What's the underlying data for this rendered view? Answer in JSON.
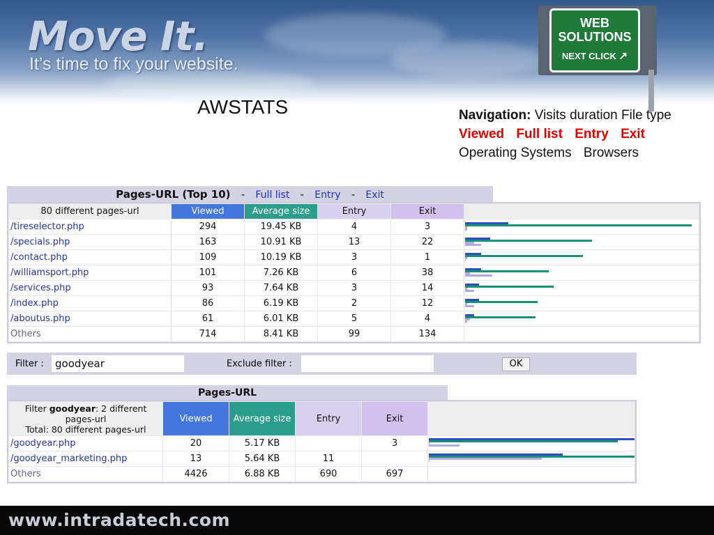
{
  "header": {
    "brand": "Move It.",
    "tagline": "It’s time to fix your website.",
    "sign": {
      "line1": "WEB",
      "line2": "SOLUTIONS",
      "line3": "NEXT CLICK",
      "arrow": "up-right-arrow-icon"
    }
  },
  "title": "AWSTATS",
  "navigation": {
    "label": "Navigation:",
    "items_line1": [
      "Visits duration",
      "File type"
    ],
    "items_red": [
      "Viewed",
      "Full list",
      "Entry",
      "Exit"
    ],
    "items_line3": [
      "Operating Systems",
      "Browsers"
    ]
  },
  "top_table": {
    "title": "Pages-URL (Top 10)",
    "links": [
      "Full list",
      "Entry",
      "Exit"
    ],
    "separator": "-",
    "summary": "80 different pages-url",
    "columns": [
      "Viewed",
      "Average size",
      "Entry",
      "Exit"
    ],
    "rows": [
      {
        "url": "/tireselector.php",
        "viewed": "294",
        "avg": "19.45 KB",
        "entry": "4",
        "exit": "3"
      },
      {
        "url": "/specials.php",
        "viewed": "163",
        "avg": "10.91 KB",
        "entry": "13",
        "exit": "22"
      },
      {
        "url": "/contact.php",
        "viewed": "109",
        "avg": "10.19 KB",
        "entry": "3",
        "exit": "1"
      },
      {
        "url": "/williamsport.php",
        "viewed": "101",
        "avg": "7.26 KB",
        "entry": "6",
        "exit": "38"
      },
      {
        "url": "/services.php",
        "viewed": "93",
        "avg": "7.64 KB",
        "entry": "3",
        "exit": "14"
      },
      {
        "url": "/index.php",
        "viewed": "86",
        "avg": "6.19 KB",
        "entry": "2",
        "exit": "12"
      },
      {
        "url": "/aboutus.php",
        "viewed": "61",
        "avg": "6.01 KB",
        "entry": "5",
        "exit": "4"
      }
    ],
    "others": {
      "label": "Others",
      "viewed": "714",
      "avg": "8.41 KB",
      "entry": "99",
      "exit": "134"
    },
    "bars": [
      [
        0.19,
        1.0,
        0.01,
        0.01
      ],
      [
        0.11,
        0.56,
        0.04,
        0.07
      ],
      [
        0.07,
        0.52,
        0.01,
        0.0
      ],
      [
        0.07,
        0.37,
        0.02,
        0.12
      ],
      [
        0.06,
        0.39,
        0.01,
        0.04
      ],
      [
        0.06,
        0.32,
        0.01,
        0.04
      ],
      [
        0.04,
        0.31,
        0.02,
        0.01
      ]
    ]
  },
  "filter": {
    "label": "Filter :",
    "value": "goodyear",
    "exclude_label": "Exclude filter :",
    "exclude_value": "",
    "ok_label": "OK"
  },
  "filtered_table": {
    "title": "Pages-URL",
    "summary_prefix": "Filter ",
    "summary_filter": "goodyear",
    "summary_suffix": ": 2 different pages-url",
    "summary_total": "Total: 80 different pages-url",
    "columns": [
      "Viewed",
      "Average size",
      "Entry",
      "Exit"
    ],
    "rows": [
      {
        "url": "/goodyear.php",
        "viewed": "20",
        "avg": "5.17 KB",
        "entry": "",
        "exit": "3"
      },
      {
        "url": "/goodyear_marketing.php",
        "viewed": "13",
        "avg": "5.64 KB",
        "entry": "11",
        "exit": ""
      }
    ],
    "others": {
      "label": "Others",
      "viewed": "4426",
      "avg": "6.88 KB",
      "entry": "690",
      "exit": "697"
    },
    "bars": [
      [
        1.0,
        0.92,
        0.0,
        0.15
      ],
      [
        0.65,
        1.0,
        0.55,
        0.0
      ]
    ]
  },
  "footer": {
    "url": "www.intradatech.com"
  },
  "colors": {
    "viewed": "#4477dd",
    "average_size": "#2a9d8c",
    "entry": "#d9d0f0",
    "exit": "#d0c2ec",
    "nav_highlight": "#e00000",
    "sign_green": "#1f7a3a"
  }
}
